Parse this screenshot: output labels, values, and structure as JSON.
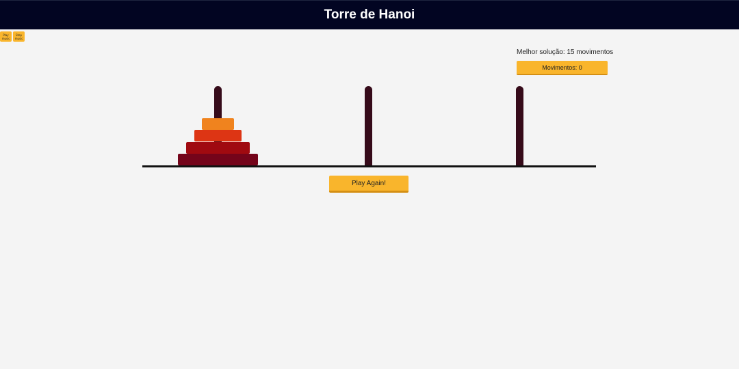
{
  "header": {
    "title": "Torre de Hanoi"
  },
  "music": {
    "play_label": "Play music",
    "stop_label": "Stop music"
  },
  "stats": {
    "best_solution": "Melhor solução: 15 movimentos",
    "moves": "Movimentos: 0"
  },
  "game": {
    "rods": [
      "rod-1",
      "rod-2",
      "rod-3"
    ],
    "disks": [
      {
        "size": 1,
        "rod": 1,
        "color": "#f0831e"
      },
      {
        "size": 2,
        "rod": 1,
        "color": "#dd3514"
      },
      {
        "size": 3,
        "rod": 1,
        "color": "#a00a10"
      },
      {
        "size": 4,
        "rod": 1,
        "color": "#74041a"
      }
    ],
    "rod_color": "#360b1a",
    "accent": "#f9b52c"
  },
  "actions": {
    "play_again": "Play Again!"
  }
}
